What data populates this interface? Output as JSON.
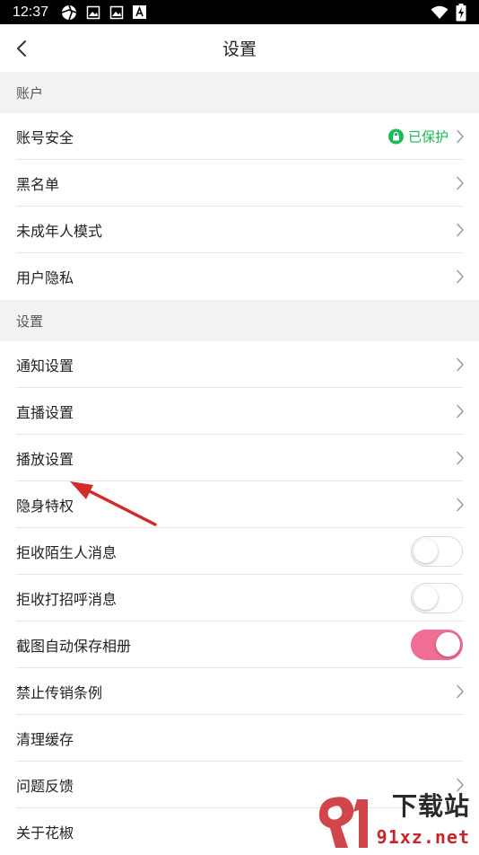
{
  "status_bar": {
    "time": "12:37",
    "icons": [
      "aperture-icon",
      "gallery-icon",
      "gallery-icon",
      "font-a-icon"
    ],
    "right_icons": [
      "wifi-icon",
      "battery-charging-icon"
    ]
  },
  "header": {
    "title": "设置",
    "back_icon": "chevron-left-icon"
  },
  "sections": [
    {
      "title": "账户",
      "items": [
        {
          "label": "账号安全",
          "status": "已保护",
          "status_icon": "lock-icon",
          "chevron": true
        },
        {
          "label": "黑名单",
          "chevron": true
        },
        {
          "label": "未成年人模式",
          "chevron": true
        },
        {
          "label": "用户隐私",
          "chevron": true
        }
      ]
    },
    {
      "title": "设置",
      "items": [
        {
          "label": "通知设置",
          "chevron": true
        },
        {
          "label": "直播设置",
          "chevron": true
        },
        {
          "label": "播放设置",
          "chevron": true
        },
        {
          "label": "隐身特权",
          "chevron": true
        },
        {
          "label": "拒收陌生人消息",
          "toggle": false
        },
        {
          "label": "拒收打招呼消息",
          "toggle": false
        },
        {
          "label": "截图自动保存相册",
          "toggle": true
        },
        {
          "label": "禁止传销条例",
          "chevron": true
        },
        {
          "label": "清理缓存"
        },
        {
          "label": "问题反馈",
          "chevron": true
        },
        {
          "label": "关于花椒"
        }
      ]
    }
  ],
  "colors": {
    "protect_green": "#19b955",
    "toggle_on": "#f06d94",
    "section_bg": "#f2f2f2",
    "annotation_arrow": "#d42a2a"
  },
  "watermark": {
    "text": "下载站",
    "sub": "91xz.net",
    "logo_icon": "91-logo-icon"
  }
}
